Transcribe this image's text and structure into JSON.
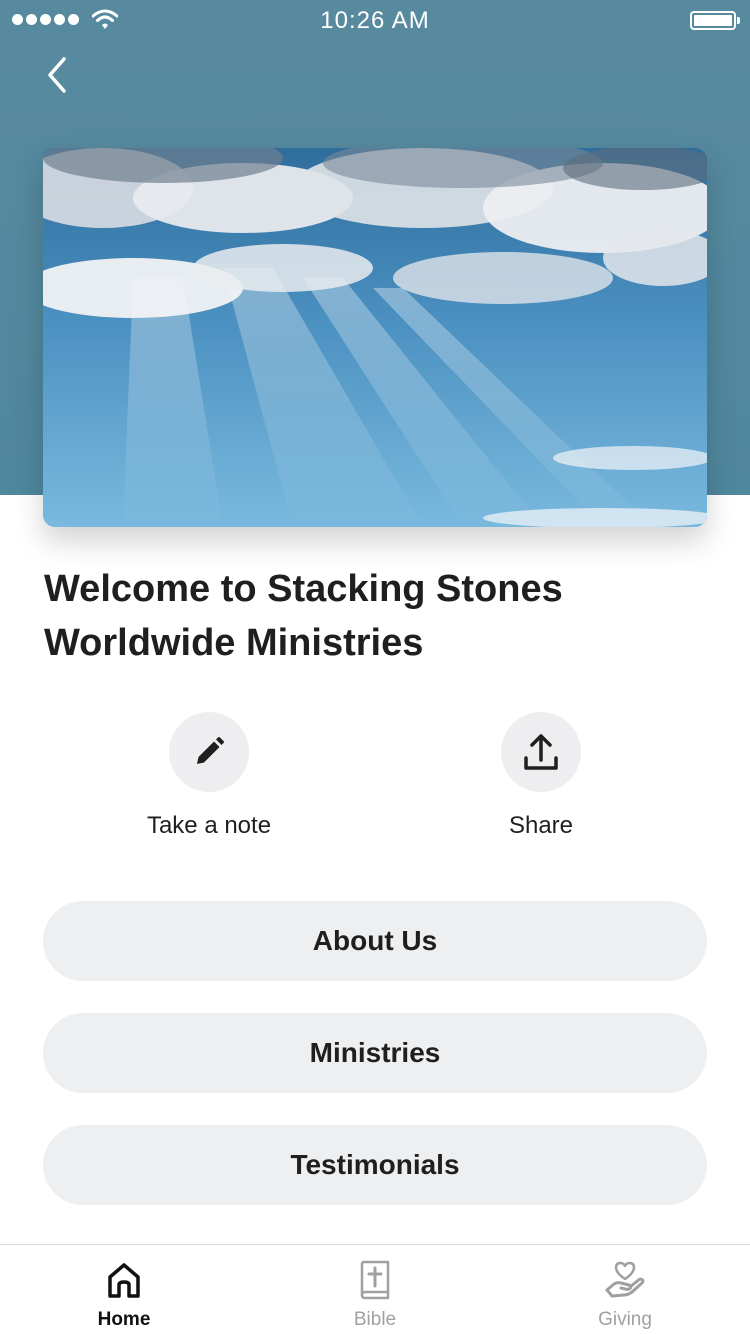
{
  "status_bar": {
    "time": "10:26 AM",
    "signal_icon": "signal-dots-icon",
    "wifi_icon": "wifi-icon",
    "battery_icon": "battery-icon",
    "battery_level": 1.0
  },
  "header": {
    "back_icon": "chevron-left-icon",
    "background_color": "#558A9E"
  },
  "hero": {
    "image": "sky-with-clouds-and-sun-rays"
  },
  "page": {
    "title": "Welcome to Stacking Stones Worldwide Ministries"
  },
  "actions": [
    {
      "label": "Take a note",
      "icon": "pencil-icon"
    },
    {
      "label": "Share",
      "icon": "share-upload-icon"
    }
  ],
  "menu": [
    {
      "label": "About Us"
    },
    {
      "label": "Ministries"
    },
    {
      "label": "Testimonials"
    }
  ],
  "tab_bar": {
    "selected": "Home",
    "tabs": [
      {
        "label": "Home",
        "icon": "home-icon",
        "active": true
      },
      {
        "label": "Bible",
        "icon": "bible-icon",
        "active": false
      },
      {
        "label": "Giving",
        "icon": "giving-hand-heart-icon",
        "active": false
      }
    ]
  }
}
